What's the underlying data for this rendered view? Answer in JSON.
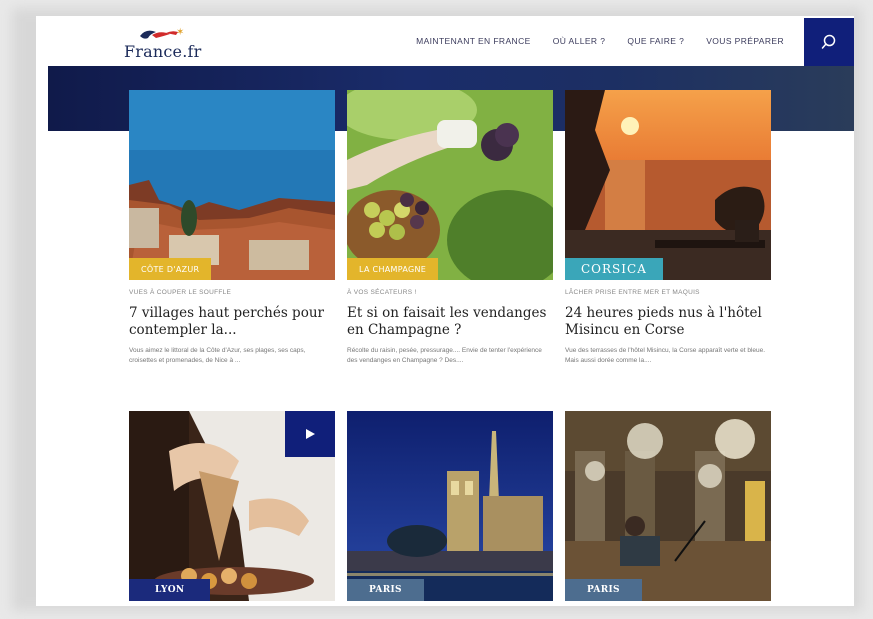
{
  "header": {
    "logo_text": "France.fr",
    "nav": [
      "MAINTENANT EN FRANCE",
      "OÙ ALLER ?",
      "QUE FAIRE ?",
      "VOUS PRÉPARER"
    ]
  },
  "cards": [
    {
      "tag": "CÔTE D'AZUR",
      "kicker": "VUES À COUPER LE SOUFFLE",
      "title": "7 villages haut perchés pour contempler la...",
      "desc": "Vous aimez le littoral de la Côte d'Azur, ses plages, ses caps, croisettes et promenades, de Nice à ..."
    },
    {
      "tag": "LA CHAMPAGNE",
      "kicker": "À VOS SÉCATEURS !",
      "title": "Et si on faisait les vendanges en Champagne ?",
      "desc": "Récolte du raisin, pesée, pressurage.... Envie de tenter l'expérience des vendanges en Champagne ? Des...."
    },
    {
      "tag": "CORSICA",
      "kicker": "LÂCHER PRISE ENTRE MER ET MAQUIS",
      "title": "24 heures pieds nus à l'hôtel Misincu en Corse",
      "desc": "Vue des terrasses de l'hôtel Misincu, la Corse apparaît verte et bleue. Mais aussi dorée comme la...."
    },
    {
      "tag": "LYON"
    },
    {
      "tag": "PARIS"
    },
    {
      "tag": "PARIS"
    }
  ],
  "colors": {
    "navy": "#101f7a",
    "yellow_tag": "#e3b52b",
    "teal_tag": "#3aa6b9",
    "slate_tag": "#4d6d8f"
  },
  "icons": {
    "search": "search-icon",
    "play": "play-icon"
  }
}
